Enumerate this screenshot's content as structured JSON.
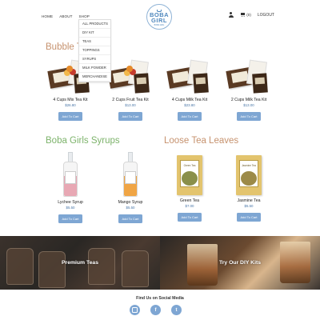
{
  "header": {
    "nav": [
      "HOME",
      "ABOUT",
      "SHOP"
    ],
    "logo": {
      "line1": "BOBA",
      "line2": "GIRL",
      "line3": "BOBA GIRL"
    },
    "cart_count": "(0)",
    "logout": "LOGOUT"
  },
  "shop_menu": [
    "ALL PRODUCTS",
    "DIY KIT",
    "TEAS",
    "TOPPINGS",
    "SYRUPS",
    "MILK POWDER",
    "MERCHANDISE"
  ],
  "sections": {
    "bubble": "Bubble Tea Kits",
    "syrups": "Boba Girls Syrups",
    "loose": "Loose Tea Leaves"
  },
  "kits": [
    {
      "name": "4 Cups Mix Tea Kit",
      "price": "$26.80",
      "button": "Add To Cart"
    },
    {
      "name": "2 Cups Fruit Tea Kit",
      "price": "$13.00",
      "button": "Add To Cart"
    },
    {
      "name": "4 Cups Milk Tea Kit",
      "price": "$23.80",
      "button": "Add To Cart"
    },
    {
      "name": "2 Cups Milk Tea Kit",
      "price": "$13.00",
      "button": "Add To Cart"
    }
  ],
  "syrups": [
    {
      "name": "Lychee Syrup",
      "price": "$5.50",
      "button": "Add To Cart",
      "color": "#e8a8b4"
    },
    {
      "name": "Mango Syrup",
      "price": "$5.50",
      "button": "Add To Cart",
      "color": "#f0a545"
    }
  ],
  "teas": [
    {
      "name": "Green Tea",
      "price": "$7.00",
      "button": "Add To Cart",
      "label": "Green Tea",
      "leaf_color": "#8a8f4a"
    },
    {
      "name": "Jasmine Tea",
      "price": "$5.50",
      "button": "Add To Cart",
      "label": "Jasmine Tea",
      "leaf_color": "#9c8a48"
    }
  ],
  "banners": {
    "left": "Premium Teas",
    "right": "Try Our DIY Kits"
  },
  "footer": {
    "title": "Find Us on Social Media",
    "social": [
      "instagram-icon",
      "facebook-icon",
      "twitter-icon"
    ],
    "fb_glyph": "f",
    "tw_glyph": "t"
  },
  "colors": {
    "accent_blue": "#7ea6d3",
    "title_brown": "#c6926e",
    "title_green": "#7db36b"
  }
}
